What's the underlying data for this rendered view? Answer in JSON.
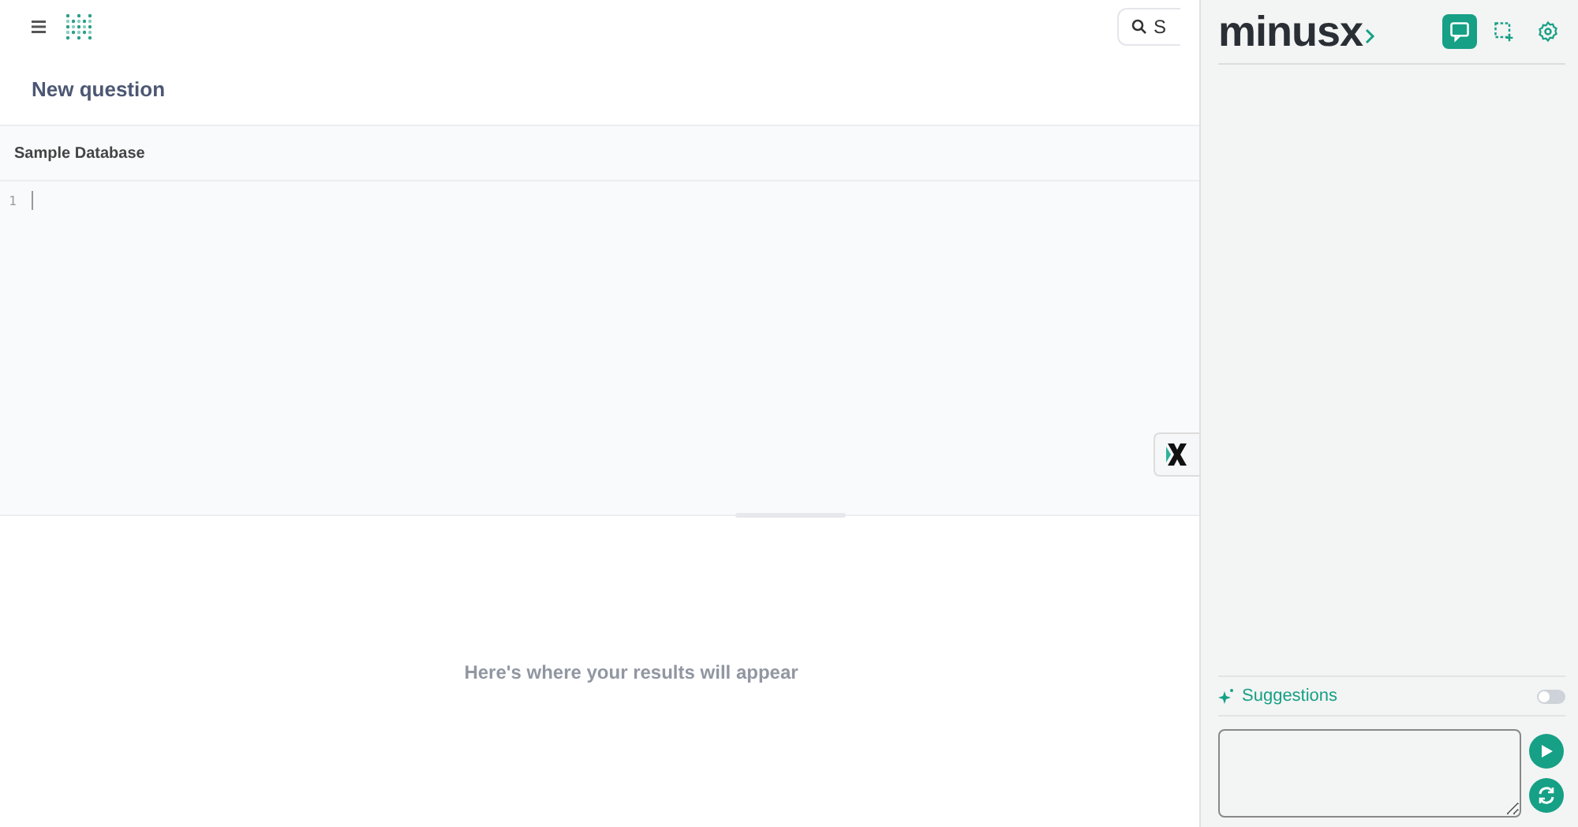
{
  "header": {
    "search": {
      "placeholder": "S"
    }
  },
  "question": {
    "title": "New question"
  },
  "editor": {
    "database": "Sample Database",
    "line_numbers": [
      "1"
    ]
  },
  "results": {
    "empty_message": "Here's where your results will appear"
  },
  "panel": {
    "logo": "minusx",
    "tabs": [
      {
        "kind": "chat",
        "selected": true
      },
      {
        "kind": "select",
        "selected": false
      },
      {
        "kind": "settings",
        "selected": false
      }
    ],
    "suggestions": {
      "label": "Suggestions",
      "on": false
    }
  }
}
